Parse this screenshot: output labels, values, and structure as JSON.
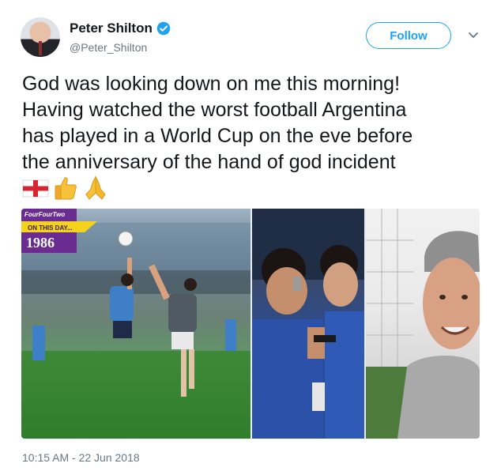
{
  "user": {
    "display_name": "Peter Shilton",
    "handle": "@Peter_Shilton",
    "verified": true,
    "follow_label": "Follow"
  },
  "tweet": {
    "text_lines": [
      "God was looking down on me this morning!",
      "Having watched the worst football Argentina",
      "has played in a World Cup on the eve before",
      "the anniversary of the hand of god incident"
    ],
    "emojis": [
      "england-flag-icon",
      "thumbs-up-icon",
      "folded-hands-icon"
    ],
    "timestamp": "10:15 AM - 22 Jun 2018"
  },
  "media": {
    "badge": {
      "brand": "FourFourTwo",
      "label": "ON THIS DAY...",
      "year": "1986"
    },
    "photos": [
      "hand-of-god-match-photo",
      "maradona-in-stands-photo",
      "shilton-portrait-photo"
    ]
  },
  "colors": {
    "accent": "#1da1f2",
    "text": "#14171a",
    "secondary": "#657786",
    "badge_purple": "#6a2c91",
    "badge_yellow": "#f5d21c"
  }
}
